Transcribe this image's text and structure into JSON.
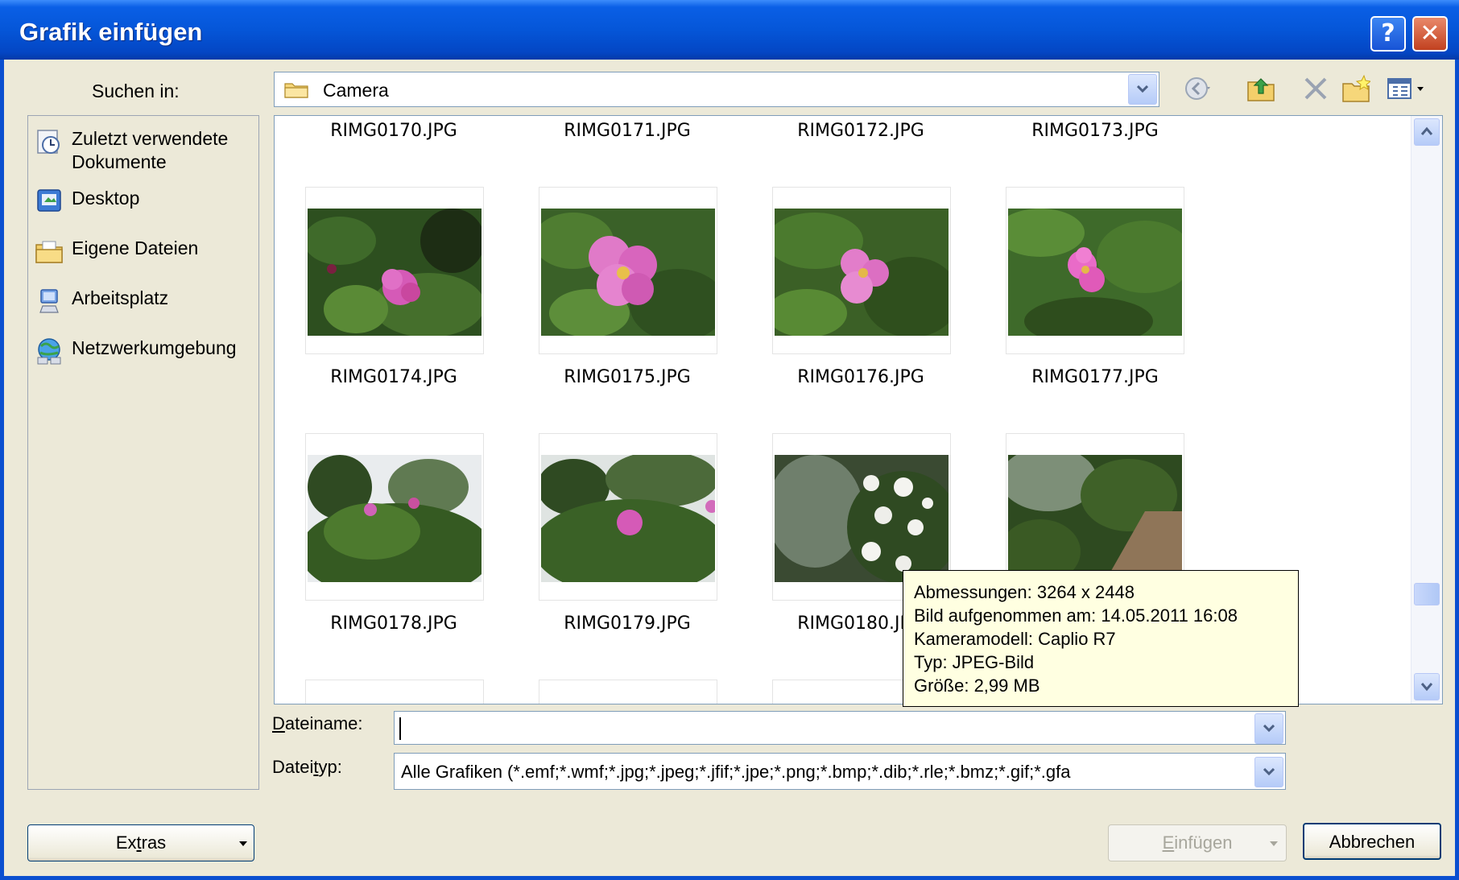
{
  "window": {
    "title": "Grafik einfügen"
  },
  "titlebar": {
    "help_glyph": "?",
    "close_glyph": "✕"
  },
  "lookin": {
    "label": "Suchen in:",
    "value": "Camera"
  },
  "toolbar": {
    "icons": [
      "back-icon",
      "up-folder-icon",
      "delete-icon",
      "new-folder-icon",
      "views-icon"
    ]
  },
  "places": {
    "items": [
      {
        "label_line1": "Zuletzt verwendete",
        "label_line2": "Dokumente",
        "icon": "recent-documents-icon"
      },
      {
        "label_line1": "Desktop",
        "label_line2": "",
        "icon": "desktop-icon"
      },
      {
        "label_line1": "Eigene Dateien",
        "label_line2": "",
        "icon": "my-documents-icon"
      },
      {
        "label_line1": "Arbeitsplatz",
        "label_line2": "",
        "icon": "my-computer-icon"
      },
      {
        "label_line1": "Netzwerkumgebung",
        "label_line2": "",
        "icon": "network-icon"
      }
    ]
  },
  "files": {
    "top_row": [
      "RIMG0170.JPG",
      "RIMG0171.JPG",
      "RIMG0172.JPG",
      "RIMG0173.JPG"
    ],
    "row1": [
      "RIMG0174.JPG",
      "RIMG0175.JPG",
      "RIMG0176.JPG",
      "RIMG0177.JPG"
    ],
    "row2": [
      "RIMG0178.JPG",
      "RIMG0179.JPG",
      "RIMG0180.JPG",
      ""
    ]
  },
  "tooltip": {
    "line1": "Abmessungen: 3264 x 2448",
    "line2": "Bild aufgenommen am: 14.05.2011 16:08",
    "line3": "Kameramodell: Caplio R7",
    "line4": "Typ: JPEG-Bild",
    "line5": "Größe: 2,99 MB"
  },
  "filename": {
    "label_pre": "",
    "label_ul": "D",
    "label_post": "ateiname:",
    "value": ""
  },
  "filetype": {
    "label_pre": "Datei",
    "label_ul": "t",
    "label_post": "yp:",
    "value": "Alle Grafiken (*.emf;*.wmf;*.jpg;*.jpeg;*.jfif;*.jpe;*.png;*.bmp;*.dib;*.rle;*.bmz;*.gif;*.gfa"
  },
  "buttons": {
    "extras_pre": "Ex",
    "extras_ul": "t",
    "extras_post": "ras",
    "insert_pre": "",
    "insert_ul": "E",
    "insert_post": "infügen",
    "cancel": "Abbrechen"
  },
  "colors": {
    "title_blue": "#0556d8",
    "face": "#ece9d8",
    "tooltip_bg": "#ffffe1",
    "close_red": "#c2411f"
  }
}
